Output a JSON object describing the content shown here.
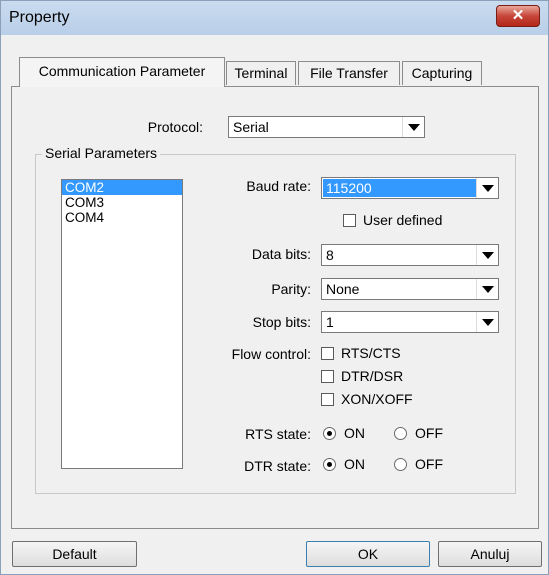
{
  "window": {
    "title": "Property",
    "close_glyph": "✕"
  },
  "tabs": [
    {
      "label": "Communication Parameter",
      "active": true
    },
    {
      "label": "Terminal",
      "active": false
    },
    {
      "label": "File Transfer",
      "active": false
    },
    {
      "label": "Capturing",
      "active": false
    }
  ],
  "protocol": {
    "label": "Protocol:",
    "value": "Serial"
  },
  "serial_parameters": {
    "group_title": "Serial Parameters",
    "ports": [
      {
        "label": "COM2",
        "selected": true
      },
      {
        "label": "COM3",
        "selected": false
      },
      {
        "label": "COM4",
        "selected": false
      }
    ],
    "baud_rate": {
      "label": "Baud rate:",
      "value": "115200"
    },
    "user_defined": {
      "label": "User defined",
      "checked": false
    },
    "data_bits": {
      "label": "Data bits:",
      "value": "8"
    },
    "parity": {
      "label": "Parity:",
      "value": "None"
    },
    "stop_bits": {
      "label": "Stop bits:",
      "value": "1"
    },
    "flow_control": {
      "label": "Flow control:",
      "options": [
        {
          "label": "RTS/CTS",
          "checked": false
        },
        {
          "label": "DTR/DSR",
          "checked": false
        },
        {
          "label": "XON/XOFF",
          "checked": false
        }
      ]
    },
    "rts_state": {
      "label": "RTS state:",
      "on_label": "ON",
      "off_label": "OFF",
      "value": "ON"
    },
    "dtr_state": {
      "label": "DTR state:",
      "on_label": "ON",
      "off_label": "OFF",
      "value": "ON"
    }
  },
  "buttons": {
    "default": "Default",
    "ok": "OK",
    "cancel": "Anuluj"
  },
  "colors": {
    "selection": "#3399ff",
    "close_button": "#c7463a",
    "titlebar": "#c9dbef"
  }
}
